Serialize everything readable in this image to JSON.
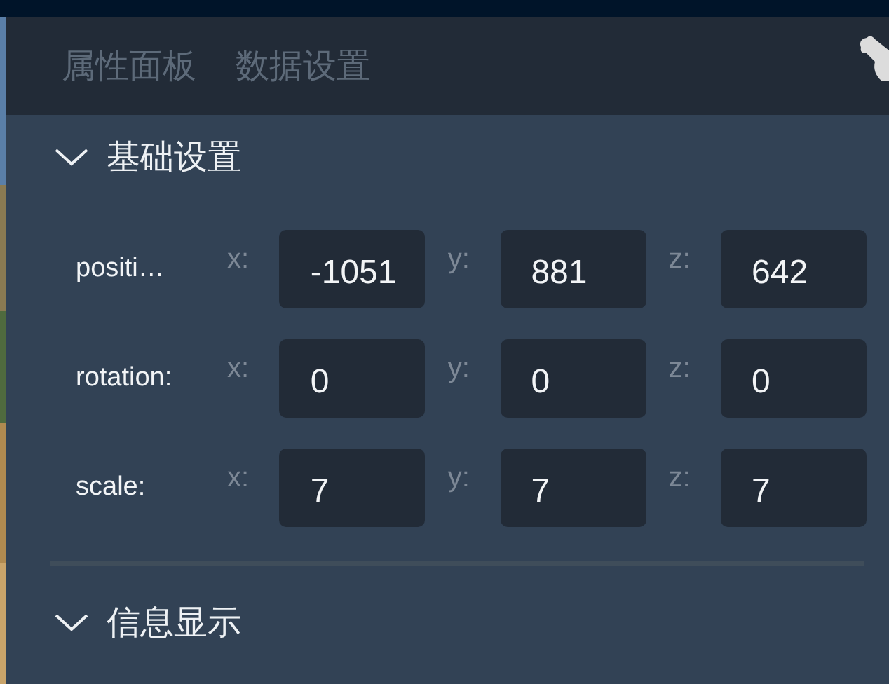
{
  "tabs": [
    {
      "label": "属性面板",
      "selected": false
    },
    {
      "label": "数据设置",
      "selected": false
    }
  ],
  "sections": [
    {
      "title": "基础设置",
      "expanded": true,
      "rows": [
        {
          "label": "positi…",
          "fields": [
            {
              "axis": "x:",
              "value": "-1051"
            },
            {
              "axis": "y:",
              "value": "881"
            },
            {
              "axis": "z:",
              "value": "642"
            }
          ]
        },
        {
          "label": "rotation:",
          "fields": [
            {
              "axis": "x:",
              "value": "0"
            },
            {
              "axis": "y:",
              "value": "0"
            },
            {
              "axis": "z:",
              "value": "0"
            }
          ]
        },
        {
          "label": "scale:",
          "fields": [
            {
              "axis": "x:",
              "value": "7"
            },
            {
              "axis": "y:",
              "value": "7"
            },
            {
              "axis": "z:",
              "value": "7"
            }
          ]
        }
      ]
    },
    {
      "title": "信息显示",
      "expanded": true
    }
  ]
}
